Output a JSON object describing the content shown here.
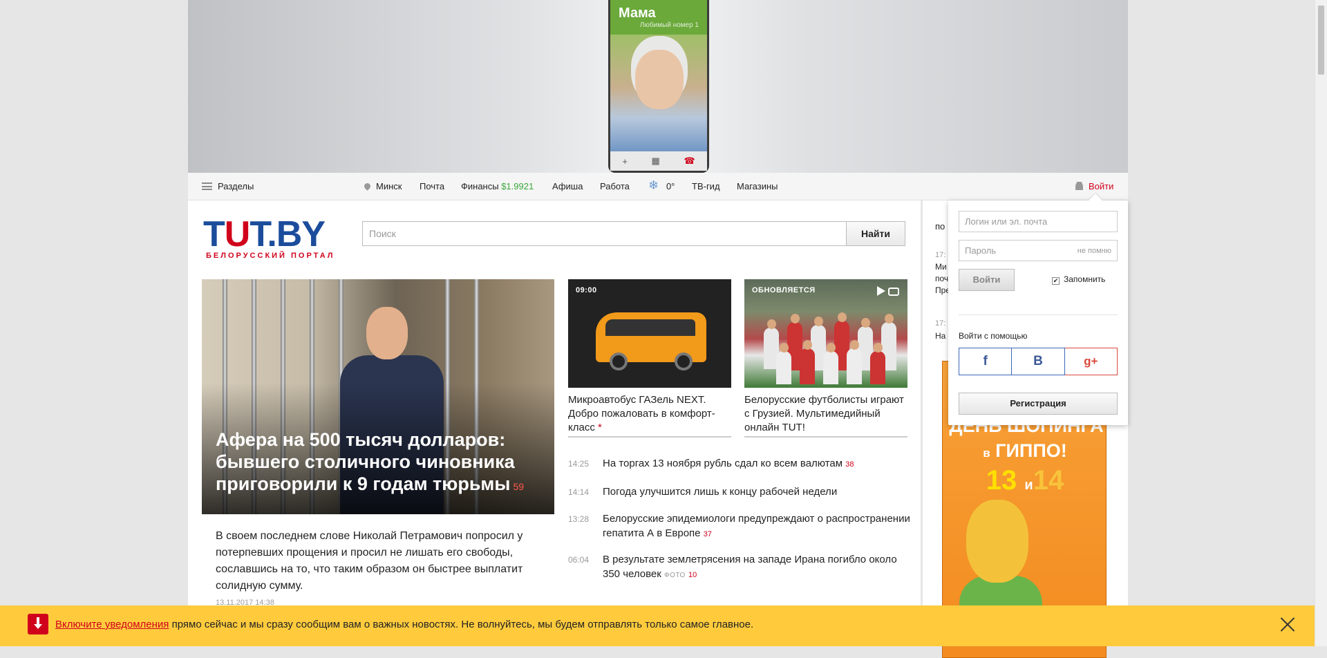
{
  "banner": {
    "phone_name": "Мама",
    "phone_subtitle": "Любимый номер 1",
    "phone_actions": [
      "+",
      "▦",
      "☎"
    ]
  },
  "nav": {
    "sections_label": "Разделы",
    "city": "Минск",
    "mail": "Почта",
    "finance_label": "Финансы",
    "finance_value": "$1.9921",
    "afisha": "Афиша",
    "work": "Работа",
    "temperature": "0°",
    "tv": "ТВ-гид",
    "shops": "Магазины",
    "login": "Войти"
  },
  "header": {
    "logo_main_left": "T",
    "logo_main_red": "U",
    "logo_main_right": "T.BY",
    "logo_sub": "БЕЛОРУССКИЙ ПОРТАЛ",
    "search_placeholder": "Поиск",
    "search_button": "Найти"
  },
  "lead": {
    "title": "Афера на 500 тысяч долларов: бывшего столичного чиновника приговорили к 9 годам тюрьмы",
    "comments": "59",
    "text": "В своем последнем слове Николай Петрамович попросил у потерпевших прощения и просил не лишать его свободы, сославшись на то, что таким образом он быстрее выплатит солидную сумму.",
    "date": "13.11.2017 14:38"
  },
  "cards": [
    {
      "badge": "09:00",
      "title": "Микроавтобус ГАЗель NEXT. Добро пожаловать в комфорт-класс",
      "mark": "*"
    },
    {
      "badge": "ОБНОВЛЯЕТСЯ",
      "title": "Белорусские футболисты играют с Грузией. Мультимедийный онлайн TUT!"
    }
  ],
  "feed": [
    {
      "time": "14:25",
      "title": "На торгах 13 ноября рубль сдал ко всем валютам",
      "count": "38"
    },
    {
      "time": "14:14",
      "title": "Погода улучшится лишь к концу рабочей недели"
    },
    {
      "time": "13:28",
      "title": "Белорусские эпидемиологи предупреждают о распространении гепатита А в Европе",
      "count": "37"
    },
    {
      "time": "06:04",
      "title": "В результате землетрясения на западе Ирана погибло около 350 человек",
      "photo": "ФОТО",
      "count": "10"
    }
  ],
  "right": {
    "heading": "по",
    "snip1_time": "17:",
    "snip1_lines": [
      "Ми",
      "поч",
      "Пре"
    ],
    "snip2_time": "17:",
    "snip2_line": "На",
    "ad": {
      "line1": "ДЕНЬ ШОПИНГА",
      "line2_small": "в",
      "line2": "ГИППО!",
      "n1": "13",
      "and": "и",
      "n2": "14"
    }
  },
  "login": {
    "login_placeholder": "Логин или эл. почта",
    "password_placeholder": "Пароль",
    "forgot": "не помню",
    "submit": "Войти",
    "remember": "Запомнить",
    "with": "Войти с помощью",
    "social": [
      "f",
      "В",
      "g+"
    ],
    "register": "Регистрация"
  },
  "notification": {
    "link": "Включите уведомления",
    "text": " прямо сейчас и мы сразу сообщим вам о важных новостях. Не волнуйтесь, мы будем отправлять только самое главное."
  }
}
